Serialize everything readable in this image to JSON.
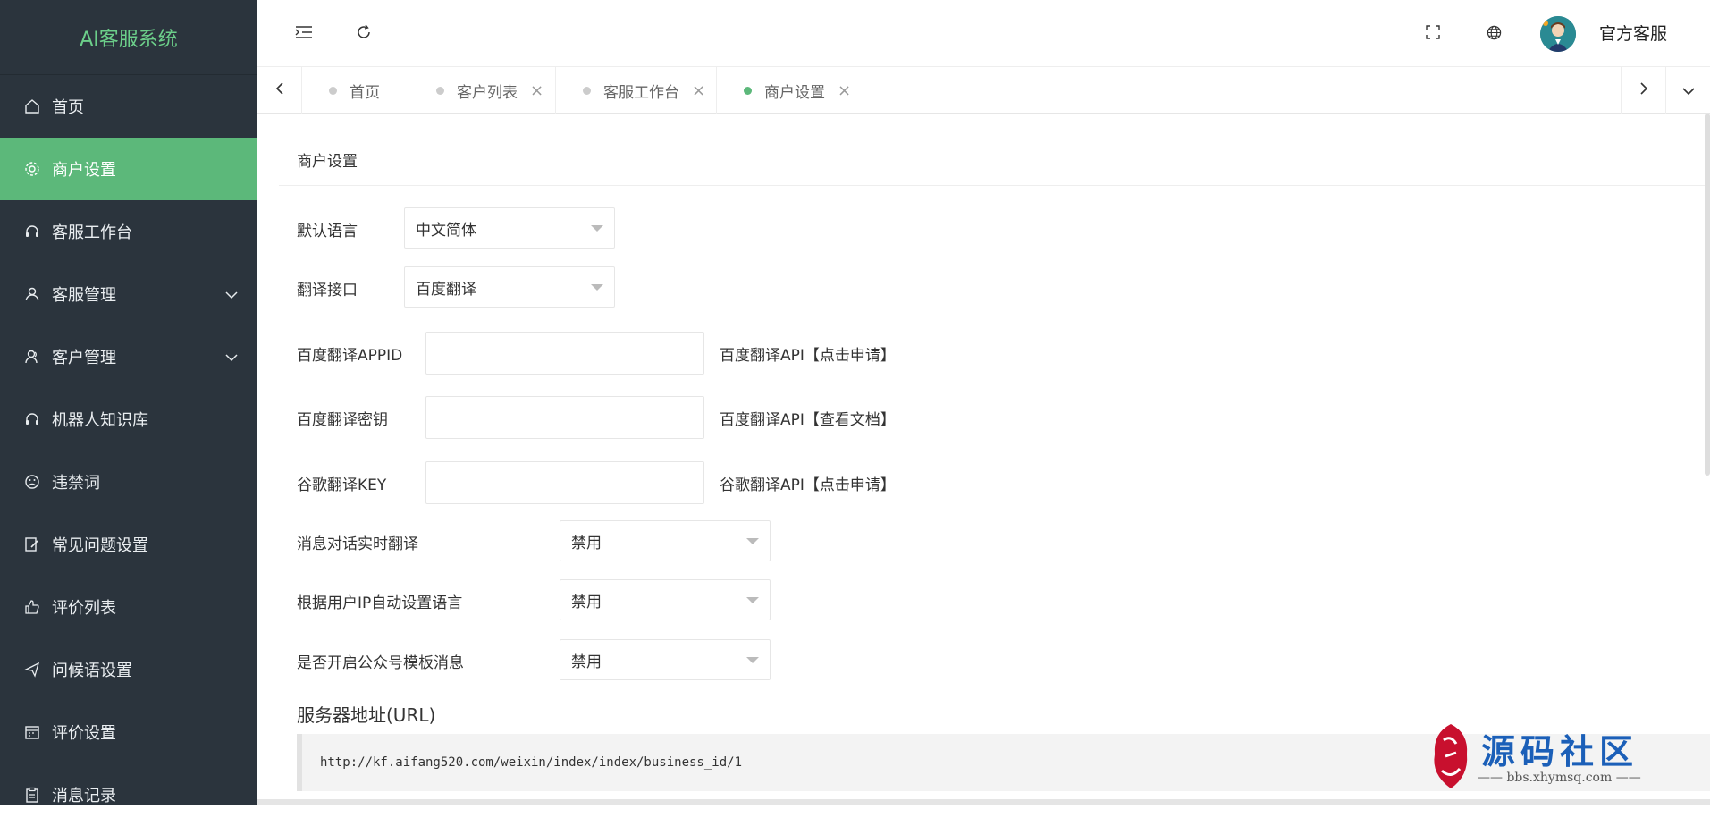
{
  "app": {
    "logo": "AI客服系统"
  },
  "sidebar": {
    "items": [
      {
        "label": "首页",
        "icon": "home-icon"
      },
      {
        "label": "商户设置",
        "icon": "gear-icon",
        "active": true
      },
      {
        "label": "客服工作台",
        "icon": "headset-icon"
      },
      {
        "label": "客服管理",
        "icon": "user-icon",
        "expandable": true
      },
      {
        "label": "客户管理",
        "icon": "users-icon",
        "expandable": true
      },
      {
        "label": "机器人知识库",
        "icon": "headset-icon"
      },
      {
        "label": "违禁词",
        "icon": "frown-icon"
      },
      {
        "label": "常见问题设置",
        "icon": "edit-icon"
      },
      {
        "label": "评价列表",
        "icon": "thumbs-up-icon"
      },
      {
        "label": "问候语设置",
        "icon": "send-icon"
      },
      {
        "label": "评价设置",
        "icon": "calendar-icon"
      },
      {
        "label": "消息记录",
        "icon": "clipboard-icon"
      }
    ]
  },
  "header": {
    "user_name": "官方客服"
  },
  "tabs": [
    {
      "label": "首页",
      "closable": false
    },
    {
      "label": "客户列表",
      "closable": true
    },
    {
      "label": "客服工作台",
      "closable": true
    },
    {
      "label": "商户设置",
      "closable": true,
      "active": true
    }
  ],
  "form": {
    "card_title": "商户设置",
    "default_language": {
      "label": "默认语言",
      "value": "中文简体"
    },
    "translate_api": {
      "label": "翻译接口",
      "value": "百度翻译"
    },
    "baidu_appid": {
      "label": "百度翻译APPID",
      "value": "",
      "link": "百度翻译API【点击申请】"
    },
    "baidu_secret": {
      "label": "百度翻译密钥",
      "value": "",
      "link": "百度翻译API【查看文档】"
    },
    "google_key": {
      "label": "谷歌翻译KEY",
      "value": "",
      "link": "谷歌翻译API【点击申请】"
    },
    "realtime_translate": {
      "label": "消息对话实时翻译",
      "value": "禁用"
    },
    "auto_language_ip": {
      "label": "根据用户IP自动设置语言",
      "value": "禁用"
    },
    "template_message": {
      "label": "是否开启公众号模板消息",
      "value": "禁用"
    },
    "server_url_title": "服务器地址(URL)",
    "server_url": "http://kf.aifang520.com/weixin/index/index/business_id/1"
  },
  "watermark": {
    "text": "源码社区",
    "site": "—— bbs.xhymsq.com ——",
    "seal": "小红"
  },
  "colors": {
    "sidebar_bg": "#2b343d",
    "accent": "#5cb87a",
    "logo": "#6ccf8a"
  }
}
